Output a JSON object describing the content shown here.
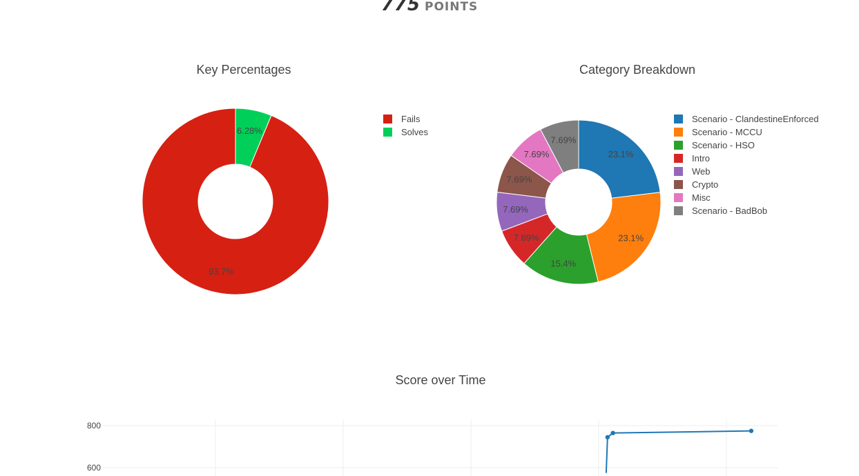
{
  "header": {
    "points_value": "775",
    "points_label": "POINTS"
  },
  "chart_data": [
    {
      "type": "pie",
      "title": "Key Percentages",
      "hole": true,
      "labels": [
        "Fails",
        "Solves"
      ],
      "values": [
        93.7,
        6.28
      ],
      "display": [
        "93.7%",
        "6.28%"
      ],
      "colors": [
        "#d62012",
        "#00d059"
      ],
      "legend": "right"
    },
    {
      "type": "pie",
      "title": "Category Breakdown",
      "hole": true,
      "labels": [
        "Scenario - ClandestineEnforced",
        "Scenario - MCCU",
        "Scenario - HSO",
        "Intro",
        "Web",
        "Crypto",
        "Misc",
        "Scenario - BadBob"
      ],
      "values": [
        23.1,
        23.1,
        15.4,
        7.69,
        7.69,
        7.69,
        7.69,
        7.69
      ],
      "display": [
        "23.1%",
        "23.1%",
        "15.4%",
        "7.69%",
        "7.69%",
        "7.69%",
        "7.69%",
        "7.69%"
      ],
      "colors": [
        "#1f77b4",
        "#ff7f0e",
        "#2ca02c",
        "#d62728",
        "#9467bd",
        "#8c564b",
        "#e377c2",
        "#7f7f7f"
      ],
      "legend": "right"
    },
    {
      "type": "line",
      "title": "Score over Time",
      "ytick_labels": [
        "600",
        "800"
      ],
      "ylim": [
        577,
        831
      ],
      "xlim": [
        0,
        100
      ],
      "x": [
        74.5,
        74.7,
        75.5,
        96
      ],
      "y": [
        575,
        745,
        765,
        775
      ],
      "color": "#1f77b4",
      "grid": true
    }
  ]
}
